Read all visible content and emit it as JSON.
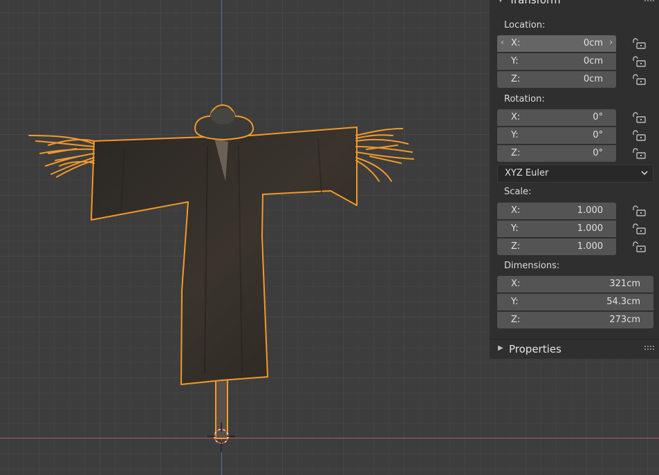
{
  "panel": {
    "transform_header": "Transform",
    "location_label": "Location:",
    "location": [
      {
        "axis": "X:",
        "value": "0cm"
      },
      {
        "axis": "Y:",
        "value": "0cm"
      },
      {
        "axis": "Z:",
        "value": "0cm"
      }
    ],
    "rotation_label": "Rotation:",
    "rotation": [
      {
        "axis": "X:",
        "value": "0°"
      },
      {
        "axis": "Y:",
        "value": "0°"
      },
      {
        "axis": "Z:",
        "value": "0°"
      }
    ],
    "rotation_mode": "XYZ Euler",
    "scale_label": "Scale:",
    "scale": [
      {
        "axis": "X:",
        "value": "1.000"
      },
      {
        "axis": "Y:",
        "value": "1.000"
      },
      {
        "axis": "Z:",
        "value": "1.000"
      }
    ],
    "dimensions_label": "Dimensions:",
    "dimensions": [
      {
        "axis": "X:",
        "value": "321cm"
      },
      {
        "axis": "Y:",
        "value": "54.3cm"
      },
      {
        "axis": "Z:",
        "value": "273cm"
      }
    ],
    "properties_header": "Properties"
  },
  "colors": {
    "selection_outline": "#f39a2a",
    "panel_bg": "#2f2f2f",
    "field_bg": "#545454",
    "x_axis": "#a0525e",
    "z_axis": "#5675a9"
  },
  "icons": {
    "lock": "unlocked-padlock-icon",
    "collapse": "triangle-icon",
    "grip": "drag-grip-icon",
    "dropdown": "chevron-down-icon"
  }
}
